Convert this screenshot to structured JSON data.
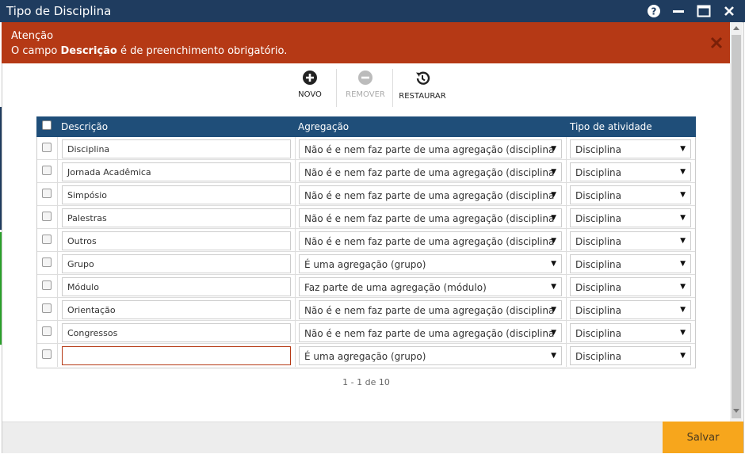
{
  "window": {
    "title": "Tipo de Disciplina"
  },
  "alert": {
    "title": "Atenção",
    "message_prefix": "O campo ",
    "message_field": "Descrição",
    "message_suffix": " é de preenchimento obrigatório."
  },
  "toolbar": {
    "novo_label": "NOVO",
    "remover_label": "REMOVER",
    "restaurar_label": "RESTAURAR"
  },
  "grid": {
    "columns": {
      "descricao": "Descrição",
      "agregacao": "Agregação",
      "tipo": "Tipo de atividade"
    },
    "rows": [
      {
        "descricao": "Disciplina",
        "agregacao": "Não é e nem faz parte de uma agregação (disciplina",
        "tipo": "Disciplina"
      },
      {
        "descricao": "Jornada Acadêmica",
        "agregacao": "Não é e nem faz parte de uma agregação (disciplina",
        "tipo": "Disciplina"
      },
      {
        "descricao": "Simpósio",
        "agregacao": "Não é e nem faz parte de uma agregação (disciplina",
        "tipo": "Disciplina"
      },
      {
        "descricao": "Palestras",
        "agregacao": "Não é e nem faz parte de uma agregação (disciplina",
        "tipo": "Disciplina"
      },
      {
        "descricao": "Outros",
        "agregacao": "Não é e nem faz parte de uma agregação (disciplina",
        "tipo": "Disciplina"
      },
      {
        "descricao": "Grupo",
        "agregacao": "É uma agregação (grupo)",
        "tipo": "Disciplina"
      },
      {
        "descricao": "Módulo",
        "agregacao": "Faz parte de uma agregação (módulo)",
        "tipo": "Disciplina"
      },
      {
        "descricao": "Orientação",
        "agregacao": "Não é e nem faz parte de uma agregação (disciplina",
        "tipo": "Disciplina"
      },
      {
        "descricao": "Congressos",
        "agregacao": "Não é e nem faz parte de uma agregação (disciplina",
        "tipo": "Disciplina"
      },
      {
        "descricao": "",
        "agregacao": "É uma agregação (grupo)",
        "tipo": "Disciplina"
      }
    ]
  },
  "pager": {
    "text": "1 - 1 de 10"
  },
  "footer": {
    "save_label": "Salvar"
  },
  "colors": {
    "titlebar": "#1f3c5f",
    "alert": "#b53915",
    "header": "#1f4e79",
    "save": "#f7a61c"
  },
  "icons": {
    "help": "help-icon",
    "minimize": "minimize-icon",
    "maximize": "maximize-icon",
    "close": "close-icon",
    "add": "plus-circle-icon",
    "remove": "minus-circle-icon",
    "restore": "history-icon"
  }
}
